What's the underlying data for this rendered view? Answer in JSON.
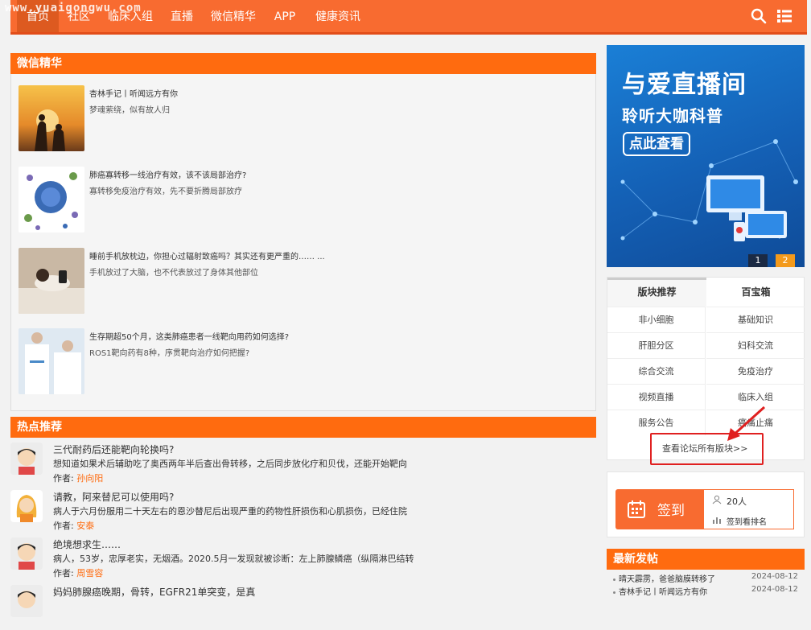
{
  "watermark": "www.yuaigongwu.com",
  "nav": {
    "items": [
      "首页",
      "社区",
      "临床入组",
      "直播",
      "微信精华",
      "APP",
      "健康资讯"
    ],
    "active_index": 0,
    "search_icon": "search-icon",
    "menu_icon": "list-menu-icon"
  },
  "wechat": {
    "header": "微信精华",
    "items": [
      {
        "title": "杏林手记丨听闻远方有你",
        "sub": "梦魂萦绕，似有故人归"
      },
      {
        "title": "肺癌寡转移一线治疗有效，该不该局部治疗?",
        "sub": "寡转移免疫治疗有效，先不要折腾局部放疗"
      },
      {
        "title": "睡前手机放枕边，你担心过辐射致癌吗？其实还有更严重的…… ...",
        "sub": "手机放过了大脑，也不代表放过了身体其他部位"
      },
      {
        "title": "生存期超50个月，这类肺癌患者一线靶向用药如何选择?",
        "sub": "ROS1靶向药有8种，序贯靶向治疗如何把握?"
      }
    ]
  },
  "hot": {
    "header": "热点推荐",
    "author_label": "作者:",
    "items": [
      {
        "title": "三代耐药后还能靶向轮换吗?",
        "desc": "想知道如果术后辅助吃了奥西两年半后查出骨转移，之后同步放化疗和贝伐，还能开始靶向",
        "author": "孙向阳"
      },
      {
        "title": "请教，阿来替尼可以使用吗?",
        "desc": "病人于六月份服用二十天左右的恩沙替尼后出现严重的药物性肝损伤和心肌损伤，已经住院",
        "author": "安泰"
      },
      {
        "title": "绝境想求生……",
        "desc": "病人，53岁，忠厚老实，无烟酒。2020.5月一发现就被诊断：左上肺腺鳞癌（纵隔淋巴结转",
        "author": "周雪容"
      },
      {
        "title": "妈妈肺腺癌晚期，骨转，EGFR21单突变，是真",
        "desc": "",
        "author": ""
      }
    ]
  },
  "banner": {
    "title": "与爱直播间",
    "subtitle": "聆听大咖科普",
    "cta": "点此查看",
    "pages": [
      "1",
      "2"
    ],
    "active_page": 1
  },
  "boards": {
    "tabs": [
      "版块推荐",
      "百宝箱"
    ],
    "cells": [
      [
        "非小细胞",
        "基础知识"
      ],
      [
        "肝胆分区",
        "妇科交流"
      ],
      [
        "综合交流",
        "免疫治疗"
      ],
      [
        "视频直播",
        "临床入组"
      ],
      [
        "服务公告",
        "癌痛止痛"
      ]
    ],
    "more": "查看论坛所有版块>>"
  },
  "signin": {
    "button": "签到",
    "count": "20人",
    "rank": "签到看排名"
  },
  "latest": {
    "header": "最新发帖",
    "items": [
      {
        "title": "晴天霹雳，爸爸脑膜转移了",
        "date": "2024-08-12"
      },
      {
        "title": "杏林手记丨听闻远方有你",
        "date": "2024-08-12"
      }
    ]
  },
  "colors": {
    "accent": "#ff6b0f",
    "nav": "#f86b30",
    "highlight": "#e02020"
  }
}
